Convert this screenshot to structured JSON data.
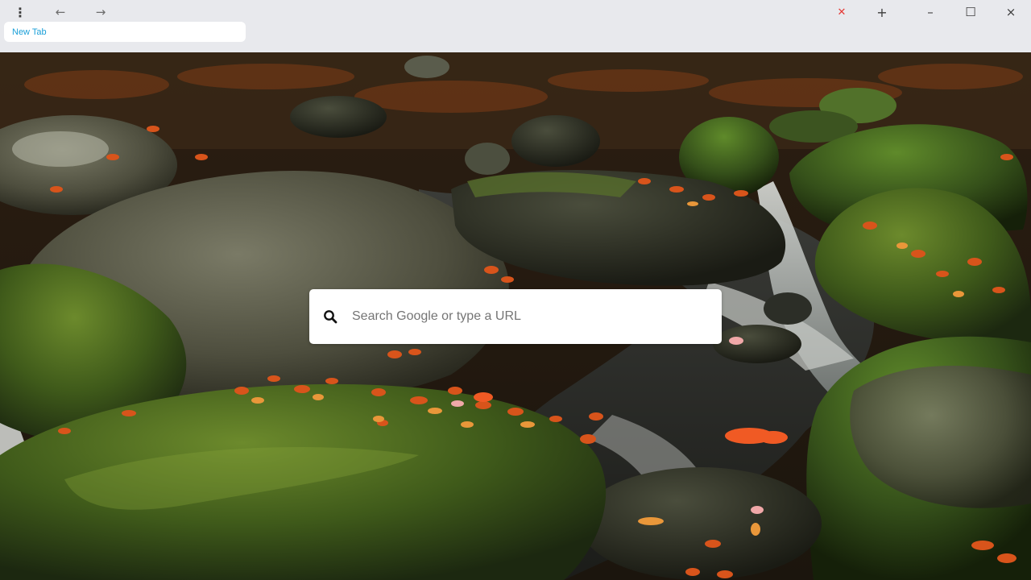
{
  "browser": {
    "menu_icon": "kebab-menu-icon",
    "back_icon": "arrow-left-icon",
    "forward_icon": "arrow-right-icon",
    "tabs": [
      {
        "title": "New Tab",
        "active": true
      }
    ],
    "close_tab_icon": "close-icon",
    "new_tab_icon": "plus-icon",
    "window_controls": [
      "minimize-icon",
      "maximize-icon",
      "close-icon"
    ],
    "glyphs": {
      "menu": "⋮",
      "back": "←",
      "forward": "→",
      "close_tab": "✕",
      "new_tab": "+",
      "minimize": "–",
      "maximize": "☐",
      "close": "×"
    },
    "colors": {
      "chrome_bg": "#e8e9ed",
      "tab_title": "#1a9fd8",
      "close_tab": "#e53935"
    }
  },
  "page": {
    "background": "mossy-rocks-waterfall-autumn-leaves",
    "search": {
      "placeholder": "Search Google or type a URL",
      "value": "",
      "icon": "search-icon"
    }
  }
}
